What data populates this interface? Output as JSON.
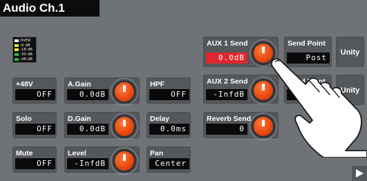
{
  "title": "Audio Ch.1",
  "meter_legend": [
    {
      "label": "OVER",
      "color": "#ffffff"
    },
    {
      "label": "-6 dB",
      "color": "#e9e23a"
    },
    {
      "label": "-18 dB",
      "color": "#e9e23a"
    },
    {
      "label": "-30 dB",
      "color": "#2fb24a"
    },
    {
      "label": "-48 dB",
      "color": "#2fb24a"
    }
  ],
  "tiles": {
    "phantom": {
      "label": "+48V",
      "value": "OFF"
    },
    "solo": {
      "label": "Solo",
      "value": "OFF"
    },
    "mute": {
      "label": "Mute",
      "value": "OFF"
    },
    "again": {
      "label": "A.Gain",
      "value": "0.0dB"
    },
    "dgain": {
      "label": "D.Gain",
      "value": "0.0dB"
    },
    "level": {
      "label": "Level",
      "value": "-InfdB"
    },
    "hpf": {
      "label": "HPF",
      "value": "OFF"
    },
    "delay": {
      "label": "Delay",
      "value": "0.0ms"
    },
    "pan": {
      "label": "Pan",
      "value": "Center"
    },
    "aux1": {
      "label": "AUX 1 Send",
      "value": "0.0dB"
    },
    "aux2": {
      "label": "AUX 2 Send",
      "value": "-InfdB"
    },
    "reverb": {
      "label": "Reverb Send",
      "value": "0"
    },
    "sendpoint1": {
      "label": "Send Point",
      "value": "Post"
    },
    "sendpoint2": {
      "label": "Send Point",
      "value": ""
    }
  },
  "unity_label": "Unity",
  "colors": {
    "accent": "#ea4a10",
    "selected": "#e0262e",
    "background": "#6f7276"
  },
  "icons": {
    "next": "right-arrow-icon",
    "hand": "pointing-hand-icon"
  }
}
